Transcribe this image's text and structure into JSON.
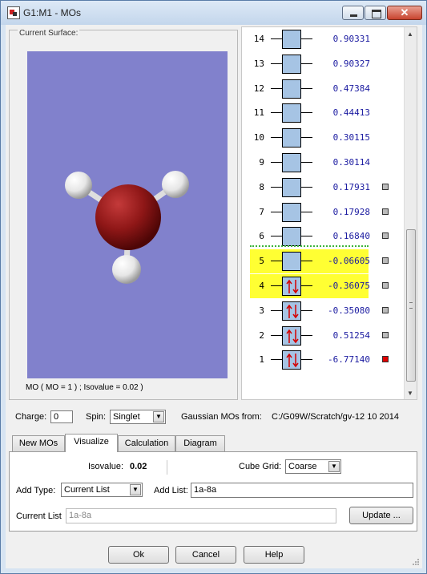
{
  "window": {
    "title": "G1:M1 - MOs",
    "close_glyph": "✕"
  },
  "surface": {
    "group_label": "Current Surface:",
    "caption": "MO ( MO = 1 ) ; Isovalue = 0.02 )"
  },
  "mo_list": [
    {
      "num": "14",
      "energy": "0.90331",
      "check": null,
      "highlight": false,
      "electrons": 0
    },
    {
      "num": "13",
      "energy": "0.90327",
      "check": null,
      "highlight": false,
      "electrons": 0
    },
    {
      "num": "12",
      "energy": "0.47384",
      "check": null,
      "highlight": false,
      "electrons": 0
    },
    {
      "num": "11",
      "energy": "0.44413",
      "check": null,
      "highlight": false,
      "electrons": 0
    },
    {
      "num": "10",
      "energy": "0.30115",
      "check": null,
      "highlight": false,
      "electrons": 0
    },
    {
      "num": "9",
      "energy": "0.30114",
      "check": null,
      "highlight": false,
      "electrons": 0
    },
    {
      "num": "8",
      "energy": "0.17931",
      "check": "gray",
      "highlight": false,
      "electrons": 0
    },
    {
      "num": "7",
      "energy": "0.17928",
      "check": "gray",
      "highlight": false,
      "electrons": 0
    },
    {
      "num": "6",
      "energy": "0.16840",
      "check": "gray",
      "highlight": false,
      "electrons": 0
    },
    {
      "num": "5",
      "energy": "-0.06605",
      "check": "gray",
      "highlight": true,
      "electrons": 0
    },
    {
      "num": "4",
      "energy": "-0.36075",
      "check": "gray",
      "highlight": true,
      "electrons": 2
    },
    {
      "num": "3",
      "energy": "-0.35080",
      "check": "gray",
      "highlight": false,
      "electrons": 2
    },
    {
      "num": "2",
      "energy": "0.51254",
      "check": "gray",
      "highlight": false,
      "electrons": 2
    },
    {
      "num": "1",
      "energy": "-6.77140",
      "check": "red",
      "highlight": false,
      "electrons": 2
    }
  ],
  "charge": {
    "label": "Charge:",
    "value": "0"
  },
  "spin": {
    "label": "Spin:",
    "value": "Singlet"
  },
  "source": {
    "label": "Gaussian MOs from:",
    "path": "C:/G09W/Scratch/gv-12 10 2014"
  },
  "tabs": [
    "New MOs",
    "Visualize",
    "Calculation",
    "Diagram"
  ],
  "active_tab": "Visualize",
  "visualize": {
    "isovalue_label": "Isovalue:",
    "isovalue": "0.02",
    "cube_grid_label": "Cube Grid:",
    "cube_grid": "Coarse",
    "add_type_label": "Add Type:",
    "add_type": "Current List",
    "add_list_label": "Add List:",
    "add_list": "1a-8a",
    "current_list_label": "Current List",
    "current_list": "1a-8a",
    "update_button": "Update ..."
  },
  "buttons": {
    "ok": "Ok",
    "cancel": "Cancel",
    "help": "Help"
  },
  "colors": {
    "viewer_bg": "#8181cc",
    "oxygen": "#8f1717",
    "hydrogen": "#f2f2f2",
    "homo_highlight": "#ffff33",
    "mo_box": "#a6c4e4"
  }
}
